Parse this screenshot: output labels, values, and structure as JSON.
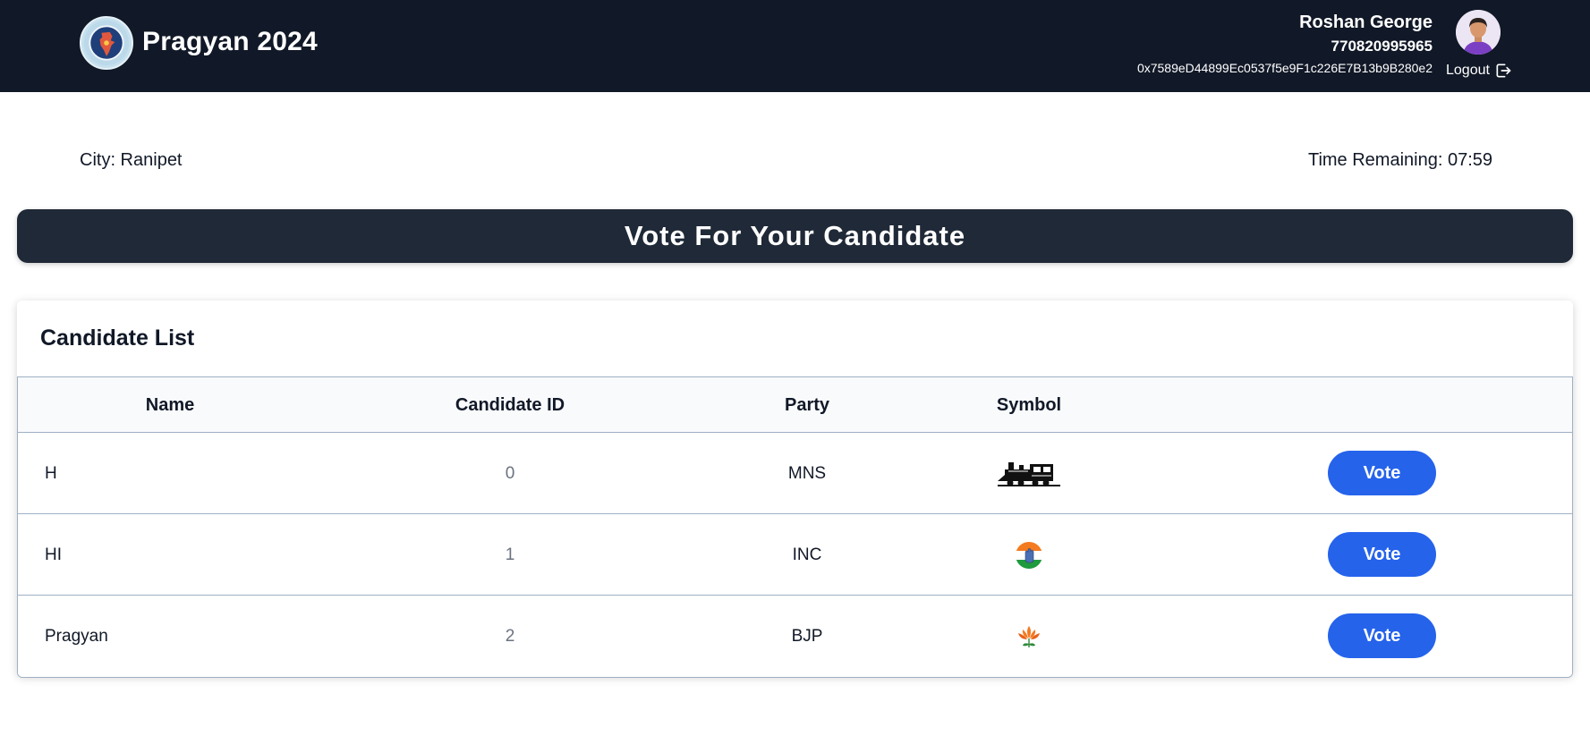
{
  "header": {
    "brand": "Pragyan 2024",
    "logo": "india-map-emblem",
    "user": {
      "name": "Roshan George",
      "phone": "770820995965",
      "wallet": "0x7589eD44899Ec0537f5e9F1c226E7B13b9B280e2"
    },
    "avatar": "user-avatar",
    "logout_label": "Logout",
    "logout_icon": "logout-icon"
  },
  "info": {
    "city": "City: Ranipet",
    "time_remaining": "Time Remaining: 07:59"
  },
  "banner": {
    "title": "Vote For Your Candidate"
  },
  "candidates": {
    "title": "Candidate List",
    "columns": [
      "Name",
      "Candidate ID",
      "Party",
      "Symbol"
    ],
    "rows": [
      {
        "name": "H",
        "id": "0",
        "party": "MNS",
        "symbol": "railway-engine-icon",
        "vote_label": "Vote"
      },
      {
        "name": "HI",
        "id": "1",
        "party": "INC",
        "symbol": "hand-tricolor-icon",
        "vote_label": "Vote"
      },
      {
        "name": "Pragyan",
        "id": "2",
        "party": "BJP",
        "symbol": "lotus-icon",
        "vote_label": "Vote"
      }
    ]
  },
  "colors": {
    "topbar": "#111827",
    "banner": "#1f2937",
    "vote_button": "#2563eb"
  }
}
